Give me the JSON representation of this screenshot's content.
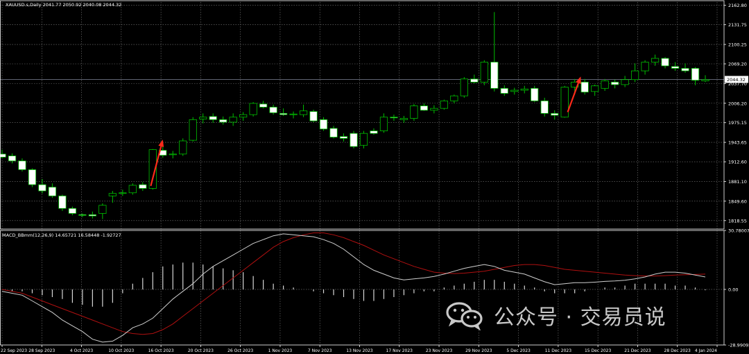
{
  "symbol_header": "XAUUSD.s,Daily  2041.77 2050.92 2040.08 2044.32",
  "macd_header": "MACD_BBmm(12,26,9) 14.65721 16.58448 -1.92727",
  "watermark": "公众号 · 交易员说",
  "colors": {
    "background": "#000000",
    "grid": "#7a7a7a",
    "bull": "#00c000",
    "bear": "#ffffff",
    "bear_outline": "#00c000",
    "macd_line": "#d0d0d0",
    "signal_line": "#b01010",
    "histogram": "#d8d8d8",
    "arrow": "#ff2a1a",
    "axis_text": "#ffffff",
    "watermark": "#c8c8c8"
  },
  "price_axis": {
    "labels": [
      "2162.80",
      "2131.75",
      "2100.25",
      "2069.20",
      "2037.70",
      "2006.20",
      "1975.15",
      "1943.65",
      "1912.60",
      "1881.10",
      "1849.60",
      "1818.55"
    ],
    "current_price": "2044.32"
  },
  "macd_axis": {
    "labels": [
      "30.78007",
      "0.00",
      "-28.99092"
    ]
  },
  "date_axis": {
    "labels": [
      "22 Sep 2023",
      "28 Sep 2023",
      "4 Oct 2023",
      "10 Oct 2023",
      "16 Oct 2023",
      "20 Oct 2023",
      "26 Oct 2023",
      "1 Nov 2023",
      "7 Nov 2023",
      "13 Nov 2023",
      "17 Nov 2023",
      "23 Nov 2023",
      "29 Nov 2023",
      "5 Dec 2023",
      "11 Dec 2023",
      "15 Dec 2023",
      "21 Dec 2023",
      "28 Dec 2023",
      "4 Jan 2024"
    ]
  },
  "chart_data": [
    {
      "type": "candlestick",
      "title": "XAUUSD.s,Daily",
      "ylim": [
        1805,
        2168
      ],
      "candles": [
        {
          "o": 1925,
          "h": 1932,
          "l": 1918,
          "c": 1920
        },
        {
          "o": 1922,
          "h": 1926,
          "l": 1910,
          "c": 1914
        },
        {
          "o": 1914,
          "h": 1918,
          "l": 1897,
          "c": 1900
        },
        {
          "o": 1900,
          "h": 1902,
          "l": 1872,
          "c": 1876
        },
        {
          "o": 1876,
          "h": 1885,
          "l": 1862,
          "c": 1866
        },
        {
          "o": 1872,
          "h": 1878,
          "l": 1855,
          "c": 1858
        },
        {
          "o": 1858,
          "h": 1860,
          "l": 1834,
          "c": 1838
        },
        {
          "o": 1838,
          "h": 1841,
          "l": 1827,
          "c": 1830
        },
        {
          "o": 1828,
          "h": 1830,
          "l": 1824,
          "c": 1827
        },
        {
          "o": 1828,
          "h": 1833,
          "l": 1822,
          "c": 1826
        },
        {
          "o": 1830,
          "h": 1846,
          "l": 1821,
          "c": 1843
        },
        {
          "o": 1858,
          "h": 1866,
          "l": 1847,
          "c": 1862
        },
        {
          "o": 1862,
          "h": 1868,
          "l": 1858,
          "c": 1863
        },
        {
          "o": 1863,
          "h": 1878,
          "l": 1860,
          "c": 1875
        },
        {
          "o": 1876,
          "h": 1880,
          "l": 1866,
          "c": 1870
        },
        {
          "o": 1870,
          "h": 1933,
          "l": 1868,
          "c": 1932
        },
        {
          "o": 1931,
          "h": 1940,
          "l": 1919,
          "c": 1923
        },
        {
          "o": 1924,
          "h": 1930,
          "l": 1918,
          "c": 1925
        },
        {
          "o": 1925,
          "h": 1950,
          "l": 1922,
          "c": 1946
        },
        {
          "o": 1947,
          "h": 1984,
          "l": 1945,
          "c": 1980
        },
        {
          "o": 1981,
          "h": 1990,
          "l": 1974,
          "c": 1984
        },
        {
          "o": 1985,
          "h": 1990,
          "l": 1975,
          "c": 1980
        },
        {
          "o": 1980,
          "h": 1985,
          "l": 1972,
          "c": 1976
        },
        {
          "o": 1976,
          "h": 1990,
          "l": 1970,
          "c": 1984
        },
        {
          "o": 1984,
          "h": 1992,
          "l": 1978,
          "c": 1988
        },
        {
          "o": 1988,
          "h": 2008,
          "l": 1985,
          "c": 2006
        },
        {
          "o": 2005,
          "h": 2010,
          "l": 1998,
          "c": 2000
        },
        {
          "o": 2000,
          "h": 2004,
          "l": 1988,
          "c": 1991
        },
        {
          "o": 1990,
          "h": 1998,
          "l": 1986,
          "c": 1988
        },
        {
          "o": 1988,
          "h": 1993,
          "l": 1982,
          "c": 1989
        },
        {
          "o": 1988,
          "h": 2004,
          "l": 1984,
          "c": 1994
        },
        {
          "o": 1993,
          "h": 1996,
          "l": 1976,
          "c": 1978
        },
        {
          "o": 1980,
          "h": 1984,
          "l": 1962,
          "c": 1965
        },
        {
          "o": 1966,
          "h": 1970,
          "l": 1950,
          "c": 1952
        },
        {
          "o": 1953,
          "h": 1958,
          "l": 1945,
          "c": 1950
        },
        {
          "o": 1958,
          "h": 1962,
          "l": 1934,
          "c": 1937
        },
        {
          "o": 1939,
          "h": 1962,
          "l": 1934,
          "c": 1958
        },
        {
          "o": 1962,
          "h": 1966,
          "l": 1956,
          "c": 1958
        },
        {
          "o": 1962,
          "h": 1990,
          "l": 1959,
          "c": 1984
        },
        {
          "o": 1984,
          "h": 1988,
          "l": 1978,
          "c": 1983
        },
        {
          "o": 1980,
          "h": 1986,
          "l": 1975,
          "c": 1982
        },
        {
          "o": 1982,
          "h": 2005,
          "l": 1978,
          "c": 2002
        },
        {
          "o": 2002,
          "h": 2006,
          "l": 1994,
          "c": 1995
        },
        {
          "o": 1995,
          "h": 2003,
          "l": 1990,
          "c": 1998
        },
        {
          "o": 1998,
          "h": 2012,
          "l": 1996,
          "c": 2010
        },
        {
          "o": 2010,
          "h": 2020,
          "l": 2006,
          "c": 2018
        },
        {
          "o": 2018,
          "h": 2048,
          "l": 2015,
          "c": 2045
        },
        {
          "o": 2045,
          "h": 2052,
          "l": 2038,
          "c": 2040
        },
        {
          "o": 2040,
          "h": 2075,
          "l": 2035,
          "c": 2072
        },
        {
          "o": 2072,
          "h": 2152,
          "l": 2025,
          "c": 2030
        },
        {
          "o": 2030,
          "h": 2035,
          "l": 2018,
          "c": 2022
        },
        {
          "o": 2025,
          "h": 2031,
          "l": 2020,
          "c": 2027
        },
        {
          "o": 2027,
          "h": 2034,
          "l": 2022,
          "c": 2029
        },
        {
          "o": 2030,
          "h": 2034,
          "l": 2008,
          "c": 2010
        },
        {
          "o": 2010,
          "h": 2015,
          "l": 1985,
          "c": 1990
        },
        {
          "o": 1990,
          "h": 1995,
          "l": 1980,
          "c": 1987
        },
        {
          "o": 1984,
          "h": 2034,
          "l": 1983,
          "c": 2032
        },
        {
          "o": 2032,
          "h": 2045,
          "l": 2020,
          "c": 2040
        },
        {
          "o": 2040,
          "h": 2045,
          "l": 2020,
          "c": 2024
        },
        {
          "o": 2025,
          "h": 2036,
          "l": 2018,
          "c": 2034
        },
        {
          "o": 2030,
          "h": 2045,
          "l": 2026,
          "c": 2042
        },
        {
          "o": 2040,
          "h": 2044,
          "l": 2030,
          "c": 2036
        },
        {
          "o": 2036,
          "h": 2050,
          "l": 2032,
          "c": 2044
        },
        {
          "o": 2044,
          "h": 2070,
          "l": 2040,
          "c": 2058
        },
        {
          "o": 2058,
          "h": 2075,
          "l": 2052,
          "c": 2072
        },
        {
          "o": 2072,
          "h": 2084,
          "l": 2066,
          "c": 2078
        },
        {
          "o": 2078,
          "h": 2080,
          "l": 2062,
          "c": 2066
        },
        {
          "o": 2065,
          "h": 2072,
          "l": 2058,
          "c": 2062
        },
        {
          "o": 2062,
          "h": 2070,
          "l": 2055,
          "c": 2058
        },
        {
          "o": 2062,
          "h": 2064,
          "l": 2035,
          "c": 2043
        },
        {
          "o": 2042,
          "h": 2051,
          "l": 2040,
          "c": 2044
        }
      ]
    },
    {
      "type": "line",
      "title": "MACD_BBmm(12,26,9)",
      "ylim": [
        -28.99092,
        30.78007
      ],
      "series": [
        {
          "values": [
            -1,
            -2,
            -3,
            -6,
            -9,
            -12,
            -16,
            -19,
            -22,
            -26,
            -27.5,
            -27,
            -24,
            -20,
            -18,
            -15,
            -10,
            -5,
            -1,
            3,
            8,
            12,
            15,
            18,
            21,
            24,
            26,
            28,
            29,
            28.5,
            28,
            27.5,
            26,
            24,
            21,
            17,
            13,
            10,
            8,
            6,
            5,
            5.5,
            6,
            6.8,
            8,
            9.5,
            11,
            12,
            13,
            12,
            10,
            9,
            8,
            6,
            4,
            2.5,
            3,
            3.5,
            3.5,
            3.8,
            4.2,
            4.4,
            4.8,
            5.5,
            6.5,
            8,
            9,
            9,
            8.5,
            7.5,
            6.5
          ]
        },
        {
          "values": [
            0,
            -1,
            -2,
            -4,
            -6,
            -8,
            -10,
            -12,
            -14,
            -16,
            -18,
            -20,
            -22,
            -23,
            -23.5,
            -23,
            -21,
            -18,
            -14,
            -10,
            -6,
            -2,
            2,
            6,
            10,
            14,
            18,
            22,
            25,
            27,
            28.5,
            29.5,
            29.5,
            28.5,
            27,
            25,
            23,
            20.5,
            18,
            16,
            14,
            12,
            10.5,
            9,
            8.5,
            8.3,
            8.5,
            9,
            9.5,
            10.5,
            11.5,
            12.5,
            13,
            13,
            12.5,
            11.5,
            10.5,
            10,
            9.5,
            9,
            8.5,
            8,
            7.5,
            7.2,
            7,
            7,
            7.2,
            7.5,
            7.7,
            7.8,
            8.0
          ]
        },
        {
          "values": [
            0,
            -1,
            -1,
            -2,
            -3,
            -4,
            -5,
            -7,
            -8,
            -9,
            -9,
            -7,
            -2,
            3,
            6,
            9,
            12,
            13,
            14,
            14,
            13,
            12,
            11,
            10,
            9,
            7,
            5,
            3,
            2,
            1,
            0,
            -1,
            -2,
            -3,
            -4,
            -5,
            -6,
            -6,
            -5,
            -4,
            -3,
            -2,
            -1,
            -1,
            1,
            2,
            3,
            4,
            5,
            5,
            4,
            3,
            2,
            1,
            -1,
            -2,
            -2,
            -2,
            -1,
            0,
            1,
            1,
            2,
            3,
            3,
            3,
            3,
            2,
            2,
            1,
            -0.4
          ]
        }
      ]
    }
  ]
}
